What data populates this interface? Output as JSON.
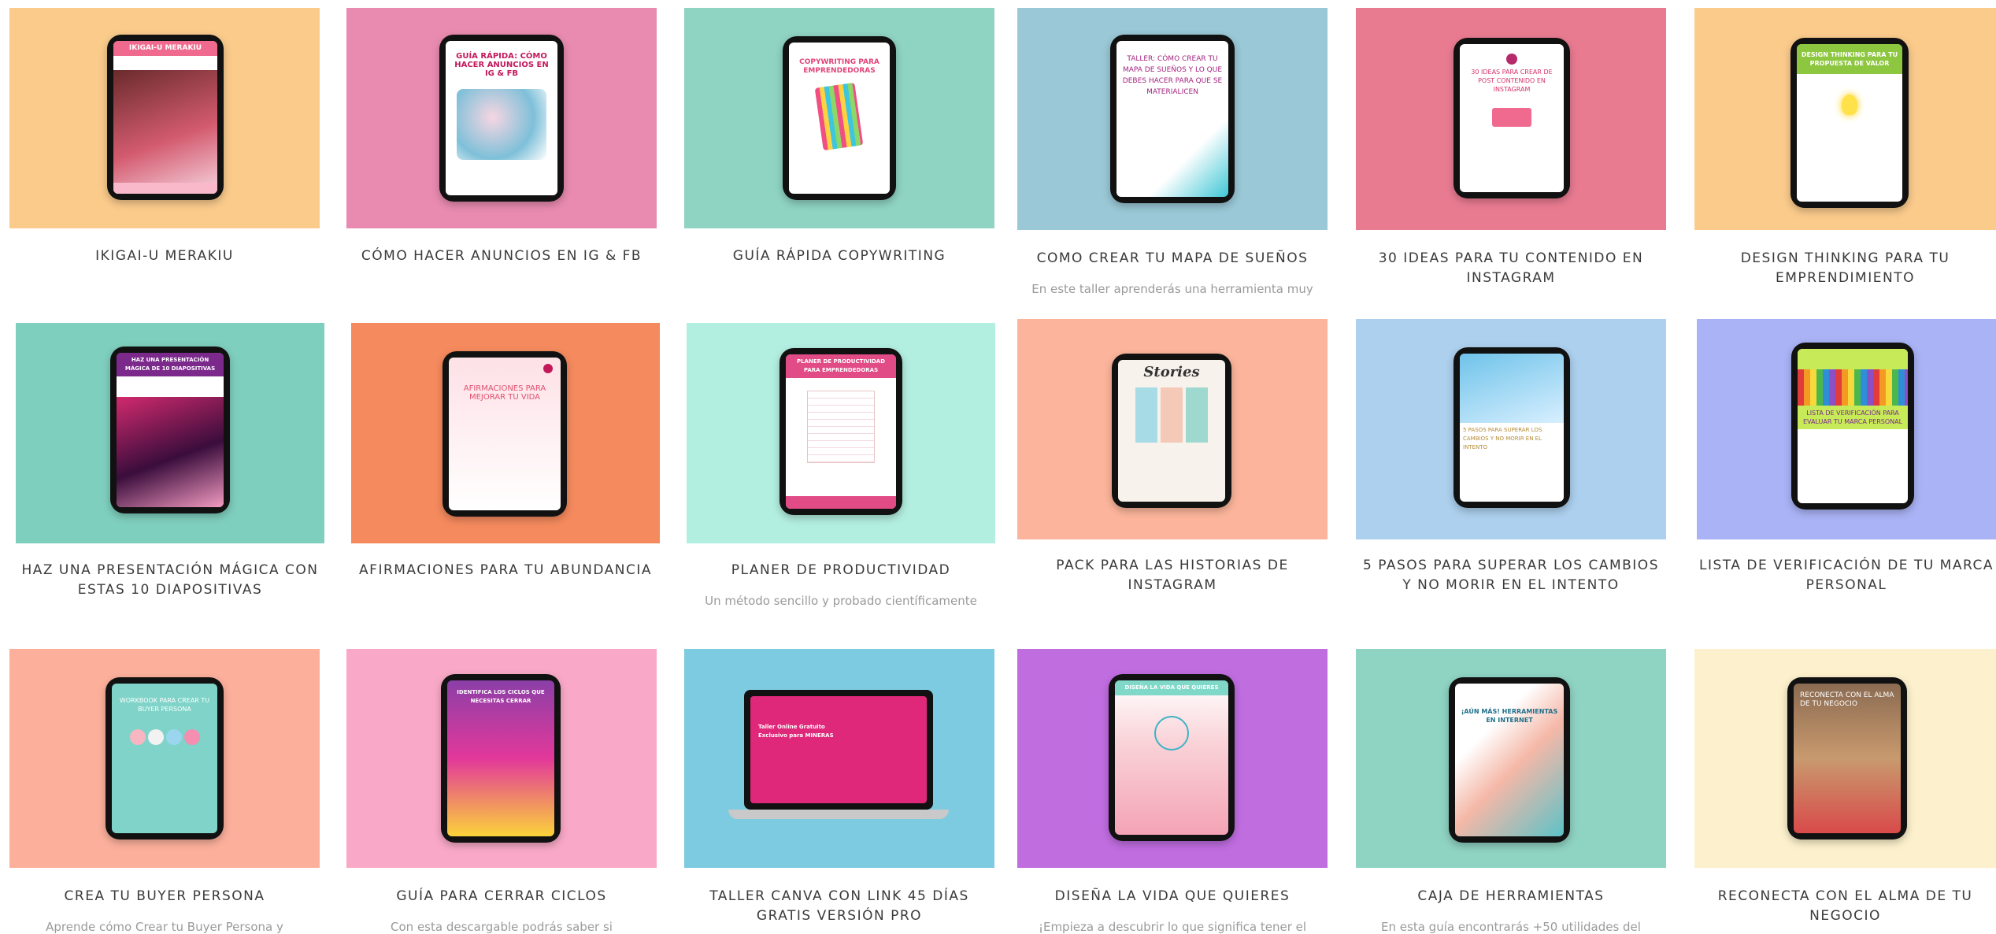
{
  "colors": {
    "peach": "#fbcb8c",
    "pink": "#e98bb0",
    "mint": "#8fd3c3",
    "blue": "#9ac8d6",
    "rose": "#e97b91",
    "sand": "#fbcb8c",
    "teal": "#7fcfbe",
    "orange": "#f58a5e",
    "aqua": "#b3efe1",
    "salmon": "#fcb59c",
    "sky": "#acd0ee",
    "lavender": "#aab3f6",
    "coral": "#fcb09c",
    "bubblegum": "#f9a9c7",
    "cyan": "#7dcbe0",
    "purple": "#c06de0",
    "seafoam": "#8fd3c3",
    "cream": "#fdf1cd"
  },
  "cards": [
    {
      "title": "IKIGAI-U MERAKIU",
      "desc": "",
      "screen": {
        "title": "IKIGAI-U MERAKIU",
        "sub": ""
      }
    },
    {
      "title": "CÓMO HACER ANUNCIOS EN IG & FB",
      "desc": "",
      "screen": {
        "title": "GUÍA RÁPIDA: Cómo hacer anuncios en IG & FB",
        "sub": ""
      }
    },
    {
      "title": "GUÍA RÁPIDA COPYWRITING",
      "desc": "",
      "screen": {
        "title": "COPYWRITING PARA EMPRENDEDORAS",
        "sub": ""
      }
    },
    {
      "title": "COMO CREAR TU MAPA DE SUEÑOS",
      "desc": "En este taller aprenderás una herramienta muy",
      "screen": {
        "title": "TALLER: CÓMO CREAR TU MAPA DE SUEÑOS Y LO QUE DEBES HACER PARA QUE SE MATERIALICEN",
        "sub": ""
      }
    },
    {
      "title": "30 IDEAS PARA TU CONTENIDO EN INSTAGRAM",
      "desc": "",
      "screen": {
        "title": "30 ideas para crear de post contenido en Instagram",
        "sub": ""
      }
    },
    {
      "title": "DESIGN THINKING PARA TU EMPRENDIMIENTO",
      "desc": "",
      "screen": {
        "title": "DESIGN THINKING PARA TU PROPUESTA DE VALOR",
        "sub": ""
      }
    },
    {
      "title": "HAZ UNA PRESENTACIÓN MÁGICA CON ESTAS 10 DIAPOSITIVAS",
      "desc": "",
      "screen": {
        "title": "HAZ UNA PRESENTACIÓN MÁGICA DE 10 DIAPOSITIVAS",
        "sub": ""
      }
    },
    {
      "title": "AFIRMACIONES PARA TU ABUNDANCIA",
      "desc": "",
      "screen": {
        "title": "AFIRMACIONES PARA MEJORAR TU VIDA",
        "sub": ""
      }
    },
    {
      "title": "PLANER DE PRODUCTIVIDAD",
      "desc": "Un método sencillo y probado científicamente",
      "screen": {
        "title": "PLANER DE PRODUCTIVIDAD PARA EMPRENDEDORAS",
        "sub": ""
      }
    },
    {
      "title": "PACK PARA LAS HISTORIAS DE INSTAGRAM",
      "desc": "",
      "screen": {
        "title": "Stories",
        "sub": ""
      }
    },
    {
      "title": "5 PASOS PARA SUPERAR LOS CAMBIOS Y NO MORIR EN EL INTENTO",
      "desc": "",
      "screen": {
        "title": "5 PASOS PARA SUPERAR LOS CAMBIOS Y NO MORIR EN EL INTENTO",
        "sub": ""
      }
    },
    {
      "title": "LISTA DE VERIFICACIÓN DE TU MARCA PERSONAL",
      "desc": "",
      "screen": {
        "title": "Lista de verificación para evaluar tu marca personal",
        "sub": ""
      }
    },
    {
      "title": "CREA TU BUYER PERSONA",
      "desc": "Aprende cómo Crear tu Buyer Persona y",
      "screen": {
        "title": "Workbook para crear tu Buyer Persona",
        "sub": ""
      }
    },
    {
      "title": "GUÍA PARA CERRAR CICLOS",
      "desc": "Con esta descargable podrás saber si",
      "screen": {
        "title": "IDENTIFICA LOS CICLOS QUE NECESITAS CERRAR",
        "sub": ""
      }
    },
    {
      "title": "TALLER CANVA CON LINK 45 DÍAS GRATIS VERSIÓN PRO",
      "desc": "",
      "screen": {
        "title": "Taller Online Gratuito Exclusivo para MINERAS",
        "sub": ""
      }
    },
    {
      "title": "DISEÑA LA VIDA QUE QUIERES",
      "desc": "¡Empieza a descubrir lo que significa tener el",
      "screen": {
        "title": "DISEÑA LA VIDA QUE QUIERES",
        "sub": ""
      }
    },
    {
      "title": "CAJA DE HERRAMIENTAS",
      "desc": "En esta guía encontrarás +50 utilidades del",
      "screen": {
        "title": "¡Aún más! HERRAMIENTAS EN INTERNET",
        "sub": ""
      }
    },
    {
      "title": "RECONECTA CON EL ALMA DE TU NEGOCIO",
      "desc": "",
      "screen": {
        "title": "RECONECTA CON EL ALMA DE TU NEGOCIO",
        "sub": ""
      }
    }
  ]
}
